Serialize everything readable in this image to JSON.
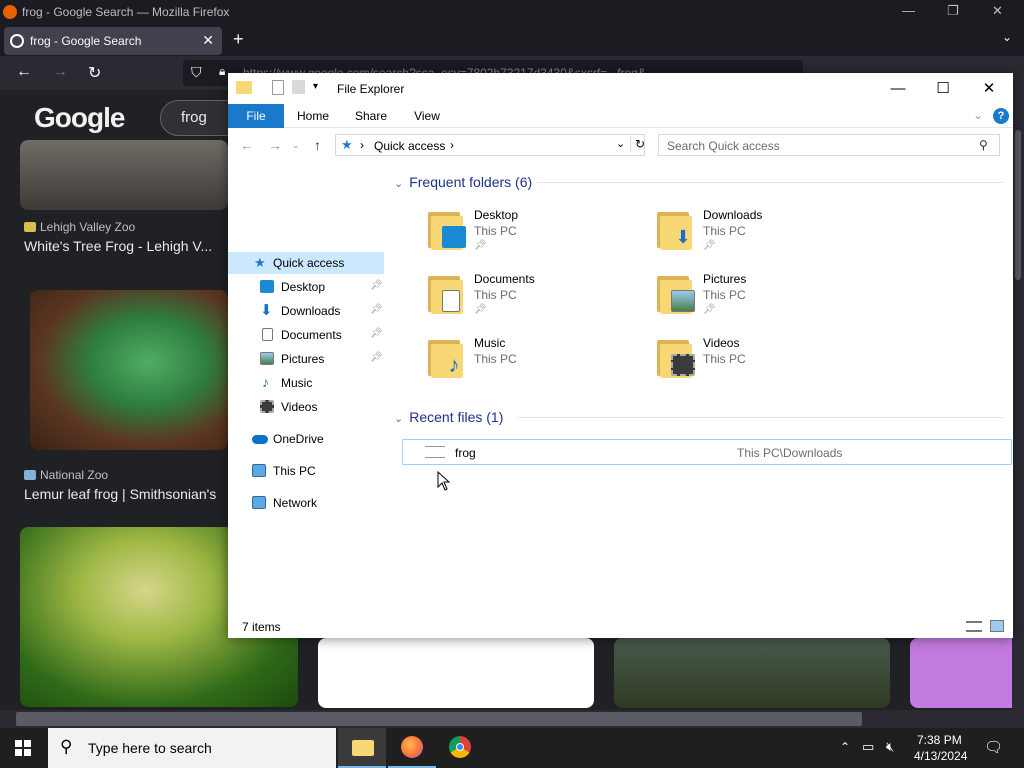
{
  "firefox": {
    "window_title": "frog - Google Search — Mozilla Firefox",
    "tab_label": "frog - Google Search",
    "url": "https://www.google.com/search?sca_esv=7802b73217d3430&sxsrf=...frog&..."
  },
  "google": {
    "logo": "Google",
    "search_query": "frog",
    "results": [
      {
        "source": "Lehigh Valley Zoo",
        "caption": "White's Tree Frog - Lehigh V..."
      },
      {
        "source": "National Zoo",
        "caption": "Lemur leaf frog | Smithsonian's"
      }
    ]
  },
  "explorer": {
    "title": "File Explorer",
    "ribbon_tabs": [
      "File",
      "Home",
      "Share",
      "View"
    ],
    "address": "Quick access",
    "search_placeholder": "Search Quick access",
    "nav_items": [
      {
        "label": "Quick access",
        "icon": "star-icon"
      },
      {
        "label": "Desktop",
        "icon": "desktop-icon",
        "pinned": true
      },
      {
        "label": "Downloads",
        "icon": "download-arrow-icon",
        "pinned": true
      },
      {
        "label": "Documents",
        "icon": "document-icon",
        "pinned": true
      },
      {
        "label": "Pictures",
        "icon": "picture-icon",
        "pinned": true
      },
      {
        "label": "Music",
        "icon": "music-note-icon"
      },
      {
        "label": "Videos",
        "icon": "video-icon"
      },
      {
        "label": "OneDrive",
        "icon": "cloud-icon"
      },
      {
        "label": "This PC",
        "icon": "computer-icon"
      },
      {
        "label": "Network",
        "icon": "network-icon"
      }
    ],
    "frequent_header": "Frequent folders (6)",
    "frequent": [
      {
        "name": "Desktop",
        "location": "This PC",
        "pinned": true
      },
      {
        "name": "Downloads",
        "location": "This PC",
        "pinned": true
      },
      {
        "name": "Documents",
        "location": "This PC",
        "pinned": true
      },
      {
        "name": "Pictures",
        "location": "This PC",
        "pinned": true
      },
      {
        "name": "Music",
        "location": "This PC"
      },
      {
        "name": "Videos",
        "location": "This PC"
      }
    ],
    "recent_header": "Recent files (1)",
    "recent": [
      {
        "name": "frog",
        "path": "This PC\\Downloads"
      }
    ],
    "status": "7 items"
  },
  "taskbar": {
    "search_placeholder": "Type here to search",
    "time": "7:38 PM",
    "date": "4/13/2024"
  },
  "colors": {
    "accent": "#1979ca",
    "selection": "#cce8ff",
    "folder": "#f8d775"
  }
}
